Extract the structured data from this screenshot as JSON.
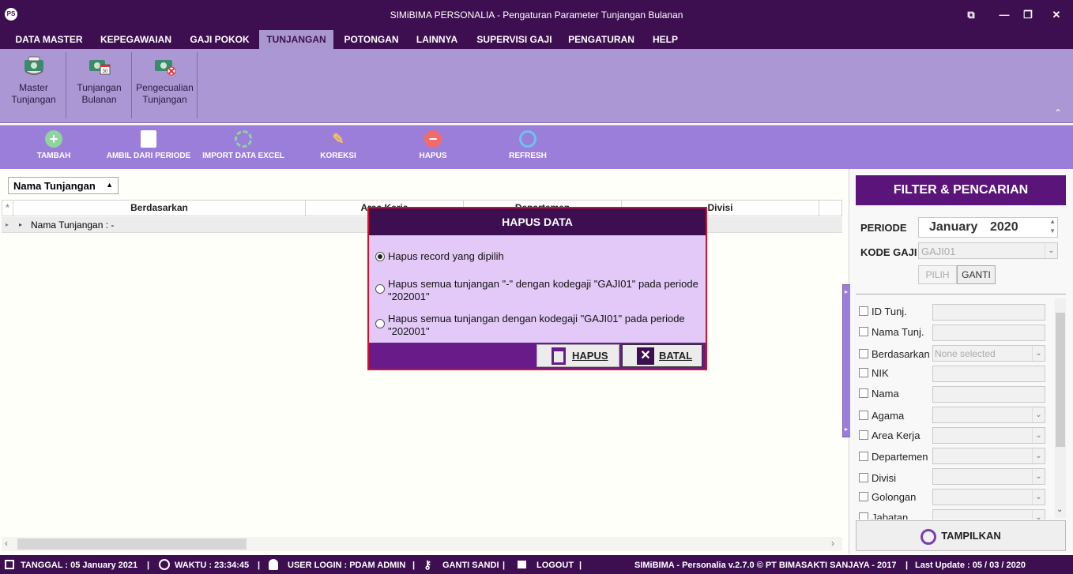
{
  "window": {
    "title": "SIMiBIMA PERSONALIA - Pengaturan Parameter Tunjangan Bulanan",
    "app_icon": "PS"
  },
  "menu": [
    "DATA MASTER",
    "KEPEGAWAIAN",
    "GAJI POKOK",
    "TUNJANGAN",
    "POTONGAN",
    "LAINNYA",
    "SUPERVISI GAJI",
    "PENGATURAN",
    "HELP"
  ],
  "ribbon": [
    {
      "line1": "Master",
      "line2": "Tunjangan"
    },
    {
      "line1": "Tunjangan",
      "line2": "Bulanan"
    },
    {
      "line1": "Pengecualian",
      "line2": "Tunjangan"
    }
  ],
  "toolbar": {
    "tambah": "TAMBAH",
    "ambil": "AMBIL DARI PERIODE",
    "import": "IMPORT DATA EXCEL",
    "koreksi": "KOREKSI",
    "hapus": "HAPUS",
    "refresh": "REFRESH"
  },
  "grid": {
    "group_by": "Nama Tunjangan",
    "columns": [
      "Berdasarkan",
      "Area Kerja",
      "Departemen",
      "Divisi"
    ],
    "group_row": "Nama Tunjangan : -"
  },
  "filter": {
    "header": "FILTER & PENCARIAN",
    "periode_label": "PERIODE",
    "periode_month": "January",
    "periode_year": "2020",
    "kode_gaji_label": "KODE GAJI",
    "kode_gaji_value": "GAJI01",
    "pilih": "PILIH",
    "ganti": "GANTI",
    "fields": [
      {
        "label": "ID Tunj.",
        "type": "text",
        "value": ""
      },
      {
        "label": "Nama Tunj.",
        "type": "text",
        "value": ""
      },
      {
        "label": "Berdasarkan",
        "type": "select",
        "value": "None selected"
      },
      {
        "label": "NIK",
        "type": "text",
        "value": ""
      },
      {
        "label": "Nama",
        "type": "text",
        "value": ""
      },
      {
        "label": "Agama",
        "type": "select",
        "value": ""
      },
      {
        "label": "Area Kerja",
        "type": "select",
        "value": ""
      },
      {
        "label": "Departemen",
        "type": "select",
        "value": ""
      },
      {
        "label": "Divisi",
        "type": "select",
        "value": ""
      },
      {
        "label": "Golongan",
        "type": "select",
        "value": ""
      },
      {
        "label": "Jabatan",
        "type": "select",
        "value": ""
      }
    ],
    "tampilkan": "TAMPILKAN"
  },
  "dialog": {
    "title": "HAPUS DATA",
    "options": [
      {
        "text": "Hapus record yang dipilih",
        "selected": true
      },
      {
        "text": "Hapus semua tunjangan \"-\" dengan kodegaji \"GAJI01\" pada periode \"202001\"",
        "selected": false
      },
      {
        "text": "Hapus semua tunjangan dengan kodegaji \"GAJI01\" pada periode \"202001\"",
        "selected": false
      }
    ],
    "hapus": "HAPUS",
    "batal": "BATAL"
  },
  "status": {
    "tanggal": "TANGGAL :  05 January 2021",
    "waktu": "WAKTU :   23:34:45",
    "user": "USER LOGIN :   PDAM ADMIN",
    "ganti_sandi": "GANTI SANDI",
    "logout": "LOGOUT",
    "version": "SIMiBIMA - Personalia v.2.7.0 © PT BIMASAKTI SANJAYA - 2017",
    "last_update": "Last Update : 05 / 03 / 2020"
  }
}
